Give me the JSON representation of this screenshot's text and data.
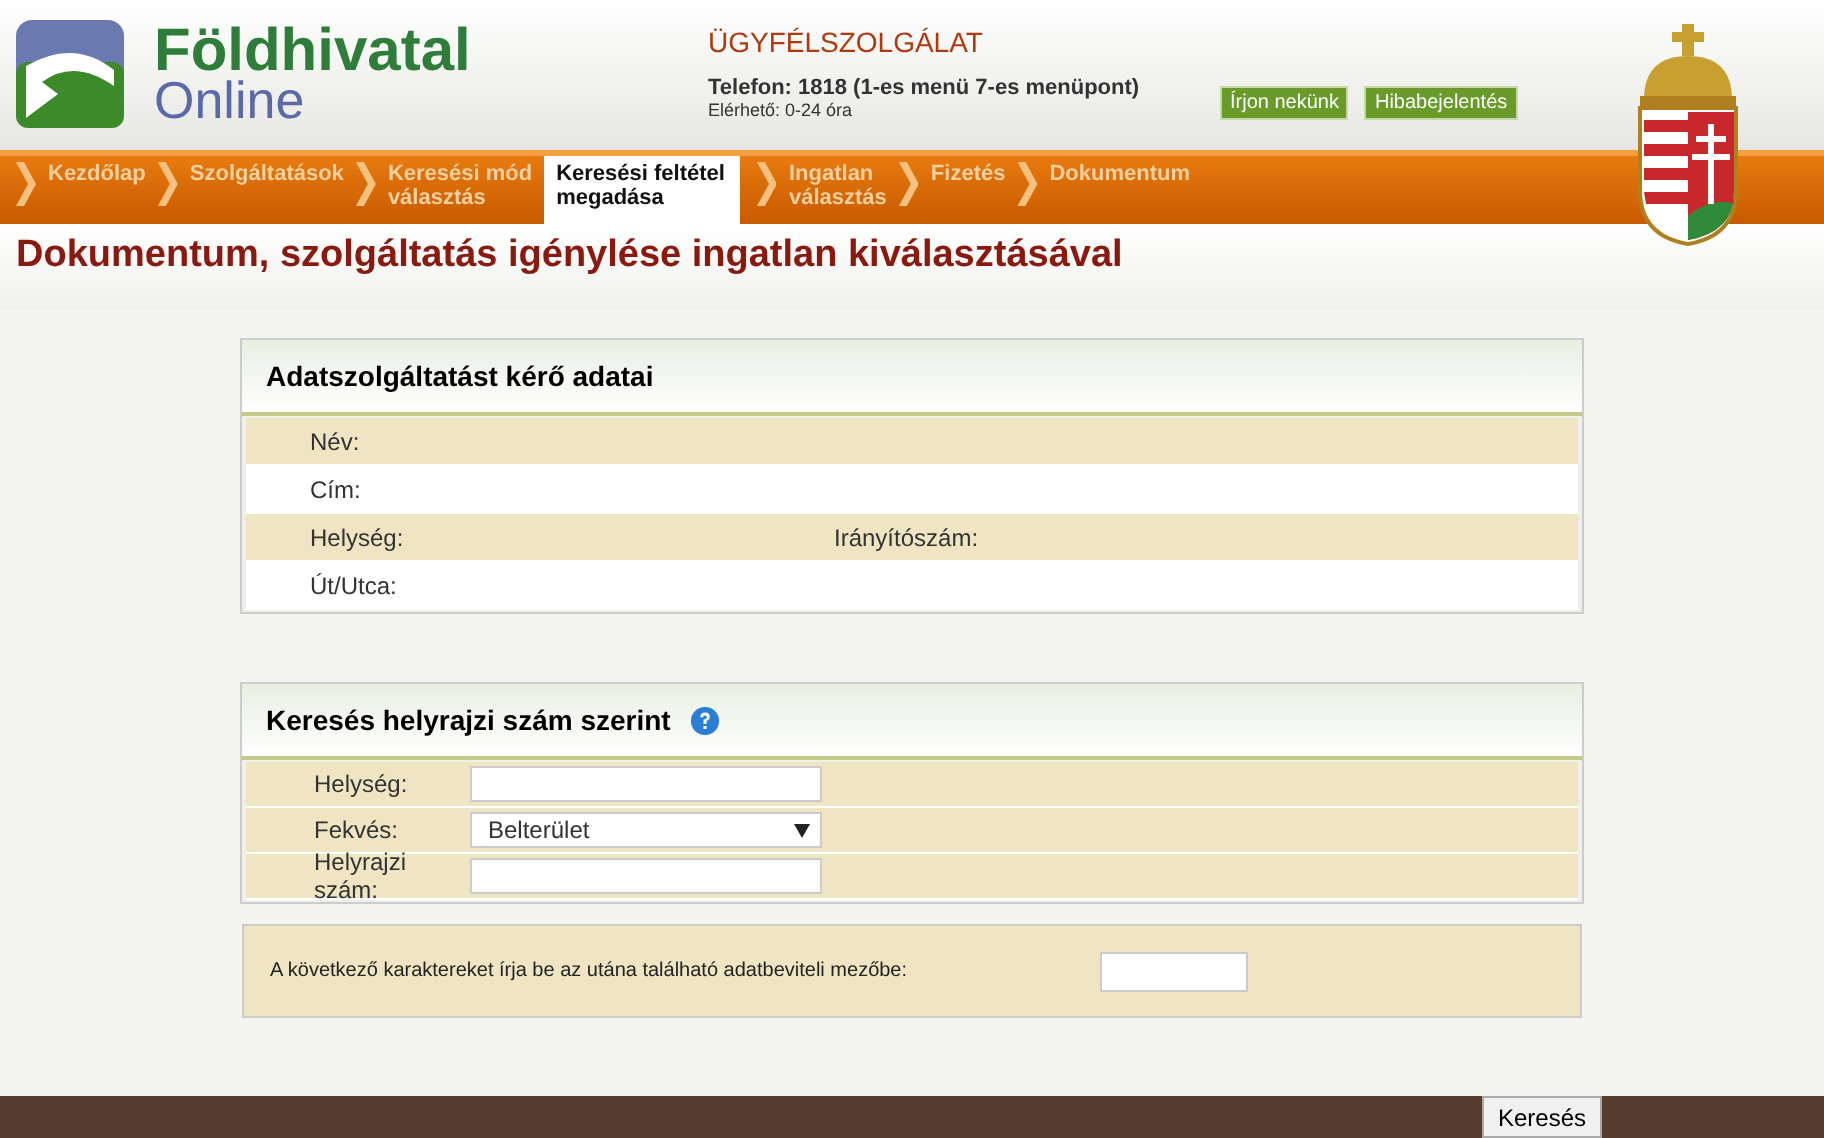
{
  "header": {
    "logo_title": "Földhivatal",
    "logo_subtitle": "Online",
    "service_title": "ÜGYFÉLSZOLGÁLAT",
    "phone": "Telefon: 1818 (1-es menü 7-es menüpont)",
    "hours": "Elérhető: 0-24 óra",
    "buttons": [
      "Írjon nekünk",
      "Hibabejelentés"
    ]
  },
  "steps": [
    {
      "label": "Kezdőlap",
      "selected": false
    },
    {
      "label": "Szolgáltatások",
      "selected": false
    },
    {
      "label": "Keresési mód\nválasztás",
      "selected": false
    },
    {
      "label": "Keresési feltétel\nmegadása",
      "selected": true
    },
    {
      "label": "Ingatlan\nválasztás",
      "selected": false
    },
    {
      "label": "Fizetés",
      "selected": false
    },
    {
      "label": "Dokumentum",
      "selected": false
    }
  ],
  "page_title": "Dokumentum, szolgáltatás igénylése ingatlan kiválasztásával",
  "requester": {
    "title": "Adatszolgáltatást kérő adatai",
    "rows": [
      {
        "cells": [
          "Név:"
        ]
      },
      {
        "cells": [
          "Cím:"
        ]
      },
      {
        "cells": [
          "Helység:",
          "Irányítószám:"
        ]
      },
      {
        "cells": [
          "Út/Utca:"
        ]
      }
    ]
  },
  "search": {
    "title": "Keresés helyrajzi szám szerint",
    "fields": [
      {
        "label": "Helység:",
        "kind": "text"
      },
      {
        "label": "Fekvés:",
        "kind": "select",
        "value": "Belterület"
      },
      {
        "label": "Helyrajzi szám:",
        "kind": "text"
      }
    ]
  },
  "captcha": {
    "label": "A következő karaktereket írja be az utána található adatbeviteli mezőbe:"
  },
  "submit": "Keresés"
}
